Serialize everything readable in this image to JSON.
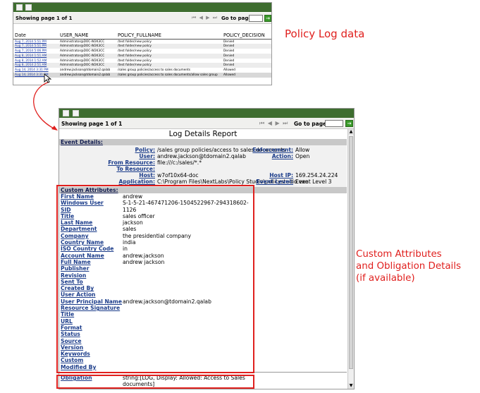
{
  "top_panel": {
    "showing": "Showing page  1  of  1",
    "nav_glyphs": "⏮ ◀ ▶ ⏭",
    "goto_label": "Go to page:",
    "go_button": "→",
    "columns": [
      "Date",
      "USER_NAME",
      "POLICY_FULLNAME",
      "POLICY_DECISION"
    ],
    "rows": [
      [
        "Aug 7, 2014 5:51 PM",
        "Administrator@DOC-W2K3CC",
        "/test folder/new policy",
        "Denied"
      ],
      [
        "Aug 7, 2014 5:51 PM",
        "Administrator@DOC-W2K3CC",
        "/test folder/new policy",
        "Denied"
      ],
      [
        "Aug 7, 2014 5:06 PM",
        "Administrator@DOC-W2K3CC",
        "/test folder/new policy",
        "Denied"
      ],
      [
        "Aug 8, 2014 1:51 AM",
        "Administrator@DOC-W2K3CC",
        "/test folder/new policy",
        "Denied"
      ],
      [
        "Aug 8, 2014 1:52 AM",
        "Administrator@DOC-W2K3CC",
        "/test folder/new policy",
        "Denied"
      ],
      [
        "Aug 8, 2014 2:51 AM",
        "Administrator@DOC-W2K3CC",
        "/test folder/new policy",
        "Denied"
      ],
      [
        "Aug 14, 2014 3:31 PM",
        "andrew.jackson@tdomain2.qalab",
        "/sales group policies/access to sales documents",
        "Allowed"
      ],
      [
        "Aug 14, 2014 3:31 PM",
        "andrew.jackson@tdomain2.qalab",
        "/sales group policies/access to sales documents/allow sales group",
        "Allowed"
      ]
    ]
  },
  "annotations": {
    "policy_log": "Policy Log data",
    "custom_line1": "Custom Attributes",
    "custom_line2": "and Obligation Details",
    "custom_line3": "(if available)"
  },
  "details_panel": {
    "showing": "Showing page  1  of  1",
    "nav_glyphs": "⏮ ◀ ▶ ⏭",
    "goto_label": "Go to page:",
    "go_button": "→",
    "title": "Log Details Report",
    "event_section": "Event Details:",
    "event": {
      "policy_k": "Policy:",
      "policy_v": "/sales group policies/access to sales documents",
      "user_k": "User:",
      "user_v": "andrew.jackson@tdomain2.qalab",
      "from_k": "From Resource:",
      "from_v": "file:///c:/sales/*.*",
      "to_k": "To Resource:",
      "to_v": "",
      "host_k": "Host:",
      "host_v": "w7of10x64-doc",
      "app_k": "Application:",
      "app_v": "C:\\Program Files\\NextLabs\\Policy Studio\\policystudio.exe",
      "enf_k": "Enforcement:",
      "enf_v": "Allow",
      "act_k": "Action:",
      "act_v": "Open",
      "hip_k": "Host IP:",
      "hip_v": "169.254.24.224",
      "lvl_k": "Event Level:",
      "lvl_v": "Event Level 3"
    },
    "custom_section": "Custom Attributes:",
    "custom": [
      {
        "k": "First Name",
        "v": "andrew"
      },
      {
        "k": "Windows User",
        "v": "S-1-5-21-467471206-1504522967-294318602-"
      },
      {
        "k": "SID",
        "v": "1126"
      },
      {
        "k": "Title",
        "v": "sales officer"
      },
      {
        "k": "Last Name",
        "v": "jackson"
      },
      {
        "k": "Department",
        "v": "sales"
      },
      {
        "k": "Company",
        "v": "the presidential company"
      },
      {
        "k": "Country Name",
        "v": "india"
      },
      {
        "k": "ISO Country Code",
        "v": "in"
      },
      {
        "k": "Account Name",
        "v": "andrew.jackson"
      },
      {
        "k": "Full Name",
        "v": "andrew jackson"
      },
      {
        "k": "Publisher",
        "v": ""
      },
      {
        "k": "Revision",
        "v": ""
      },
      {
        "k": "Sent To",
        "v": ""
      },
      {
        "k": "Created By",
        "v": ""
      },
      {
        "k": "User Action",
        "v": ""
      },
      {
        "k": "User Principal Name",
        "v": "andrew.jackson@tdomain2.qalab"
      },
      {
        "k": "Resource Signature",
        "v": ""
      },
      {
        "k": "Title",
        "v": ""
      },
      {
        "k": "URL",
        "v": ""
      },
      {
        "k": "Format",
        "v": ""
      },
      {
        "k": "Status",
        "v": ""
      },
      {
        "k": "Source",
        "v": ""
      },
      {
        "k": "Version",
        "v": ""
      },
      {
        "k": "Keywords",
        "v": ""
      },
      {
        "k": "Custom",
        "v": ""
      },
      {
        "k": "Modified By",
        "v": ""
      }
    ],
    "obligation_k": "Obligation",
    "obligation_v": "string:[LOG, Display: Allowed: Access to Sales documents]"
  }
}
